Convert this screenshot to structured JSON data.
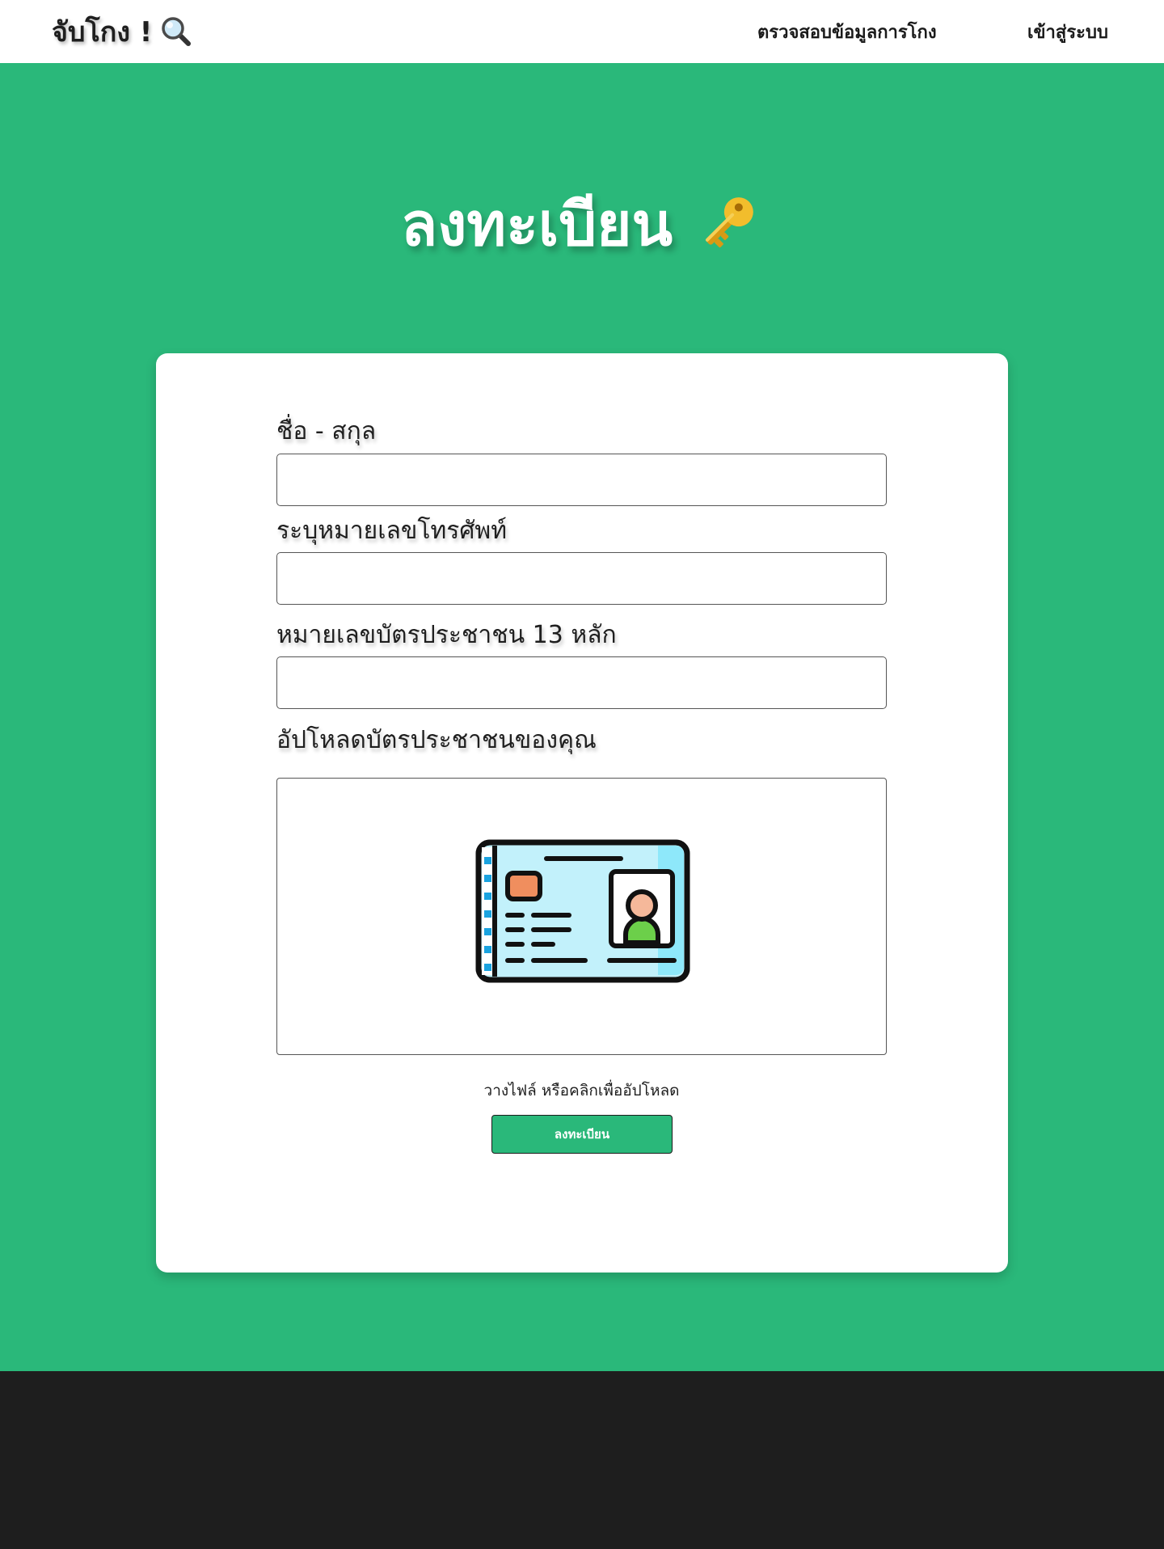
{
  "navbar": {
    "brand": "จับโกง !",
    "brand_icon": "magnifier-icon",
    "links": [
      {
        "label": "ตรวจสอบข้อมูลการโกง"
      },
      {
        "label": "เข้าสู่ระบบ"
      }
    ]
  },
  "hero": {
    "title": "ลงทะเบียน",
    "icon": "key-icon"
  },
  "form": {
    "fields": [
      {
        "label": "ชื่อ - สกุล",
        "value": ""
      },
      {
        "label": "ระบุหมายเลขโทรศัพท์",
        "value": ""
      },
      {
        "label": "หมายเลขบัตรประชาชน 13 หลัก",
        "value": ""
      }
    ],
    "upload": {
      "label": "อัปโหลดบัตรประชาชนของคุณ",
      "icon": "id-card-icon",
      "hint": "วางไฟล์ หรือคลิกเพื่ออัปโหลด"
    },
    "submit_label": "ลงทะเบียน"
  },
  "colors": {
    "brand_green": "#2ab87a",
    "footer": "#1e1e1e",
    "card": "#ffffff"
  }
}
